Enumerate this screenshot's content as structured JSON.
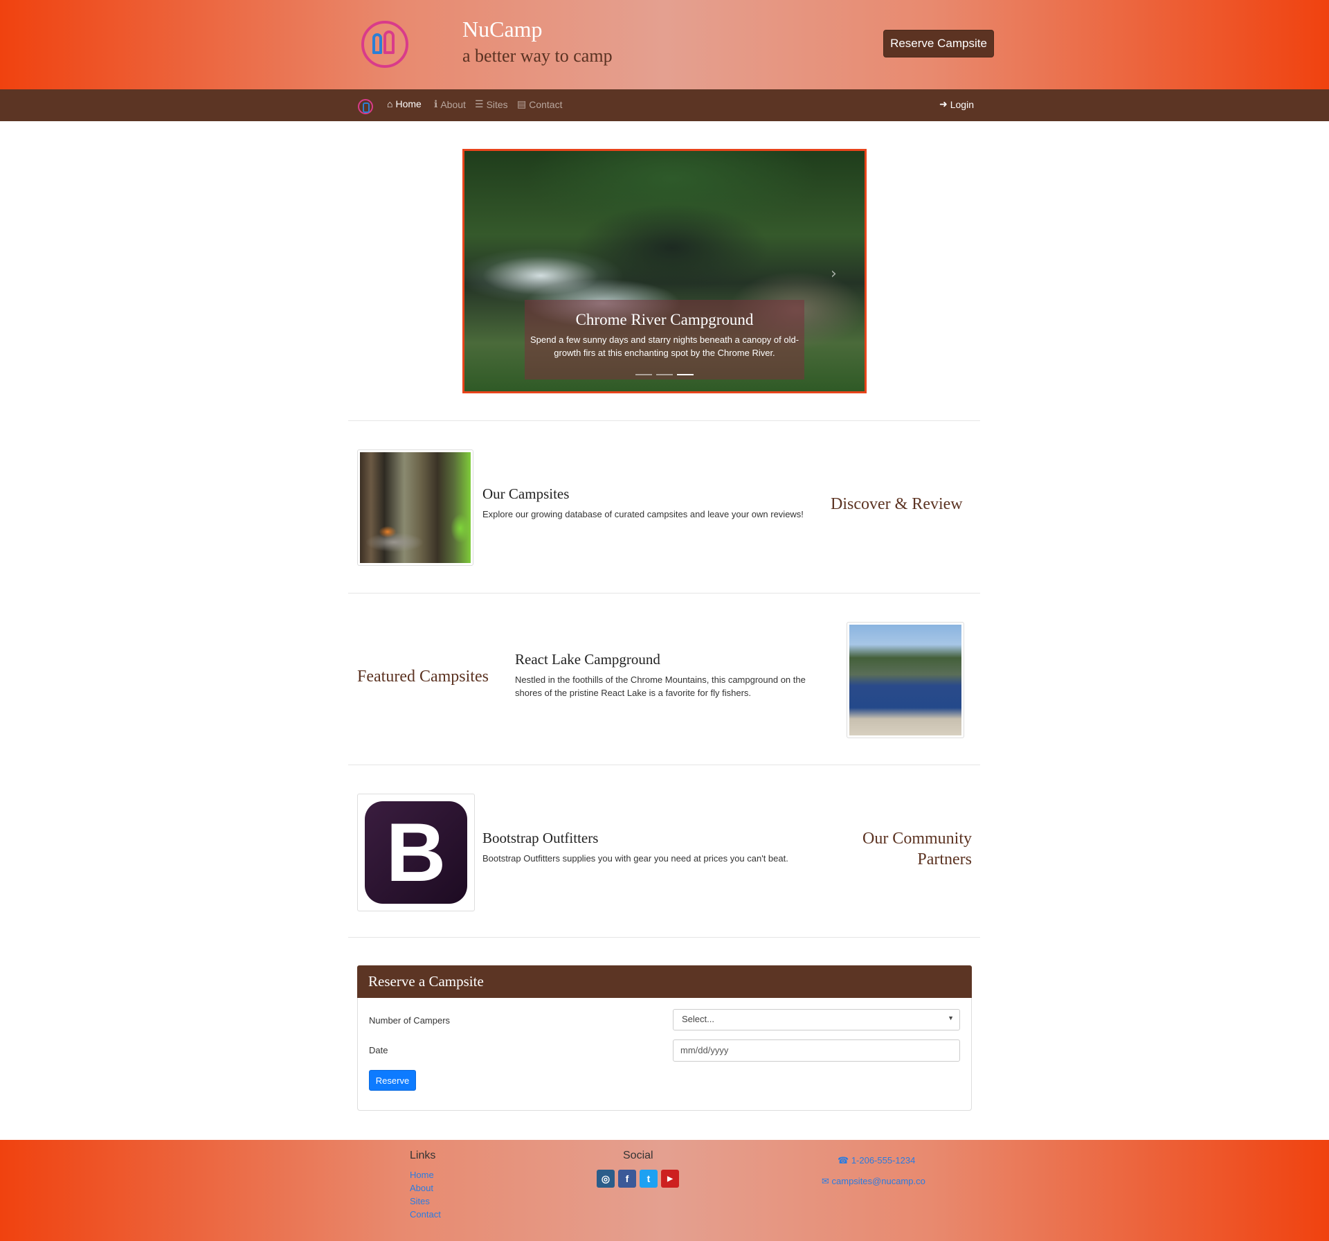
{
  "header": {
    "brand_title": "NuCamp",
    "brand_subtitle": "a better way to camp",
    "reserve_button": "Reserve Campsite"
  },
  "nav": {
    "items": [
      {
        "label": "Home",
        "icon": "home-icon",
        "active": true
      },
      {
        "label": "About",
        "icon": "info-icon",
        "active": false
      },
      {
        "label": "Sites",
        "icon": "list-icon",
        "active": false
      },
      {
        "label": "Contact",
        "icon": "address-card-icon",
        "active": false
      }
    ],
    "login": "Login"
  },
  "carousel": {
    "caption_title": "Chrome River Campground",
    "caption_text": "Spend a few sunny days and starry nights beneath a canopy of old-growth firs at this enchanting spot by the Chrome River.",
    "slide_count": 3,
    "active_slide": 3
  },
  "rows": [
    {
      "title": "Our Campsites",
      "text": "Explore our growing database of curated campsites and leave your own reviews!",
      "side_heading": "Discover & Review"
    },
    {
      "title": "React Lake Campground",
      "text": "Nestled in the foothills of the Chrome Mountains, this campground on the shores of the pristine React Lake is a favorite for fly fishers.",
      "side_heading": "Featured Campsites"
    },
    {
      "title": "Bootstrap Outfitters",
      "text": "Bootstrap Outfitters supplies you with gear you need at prices you can't beat.",
      "side_heading_line1": "Our Community",
      "side_heading_line2": "Partners",
      "logo_letter": "B"
    }
  ],
  "reserve_form": {
    "title": "Reserve a Campsite",
    "campers_label": "Number of Campers",
    "campers_value": "Select...",
    "date_label": "Date",
    "date_placeholder": "mm/dd/yyyy",
    "submit": "Reserve"
  },
  "footer": {
    "links_heading": "Links",
    "links": [
      "Home",
      "About",
      "Sites",
      "Contact"
    ],
    "social_heading": "Social",
    "social": [
      "instagram-icon",
      "facebook-icon",
      "twitter-icon",
      "youtube-icon"
    ],
    "phone": "1-206-555-1234",
    "email": "campsites@nucamp.co"
  },
  "colors": {
    "accent": "#f0420f",
    "brown": "#5c3524",
    "link": "#2a7be0",
    "button": "#0d7bff"
  }
}
